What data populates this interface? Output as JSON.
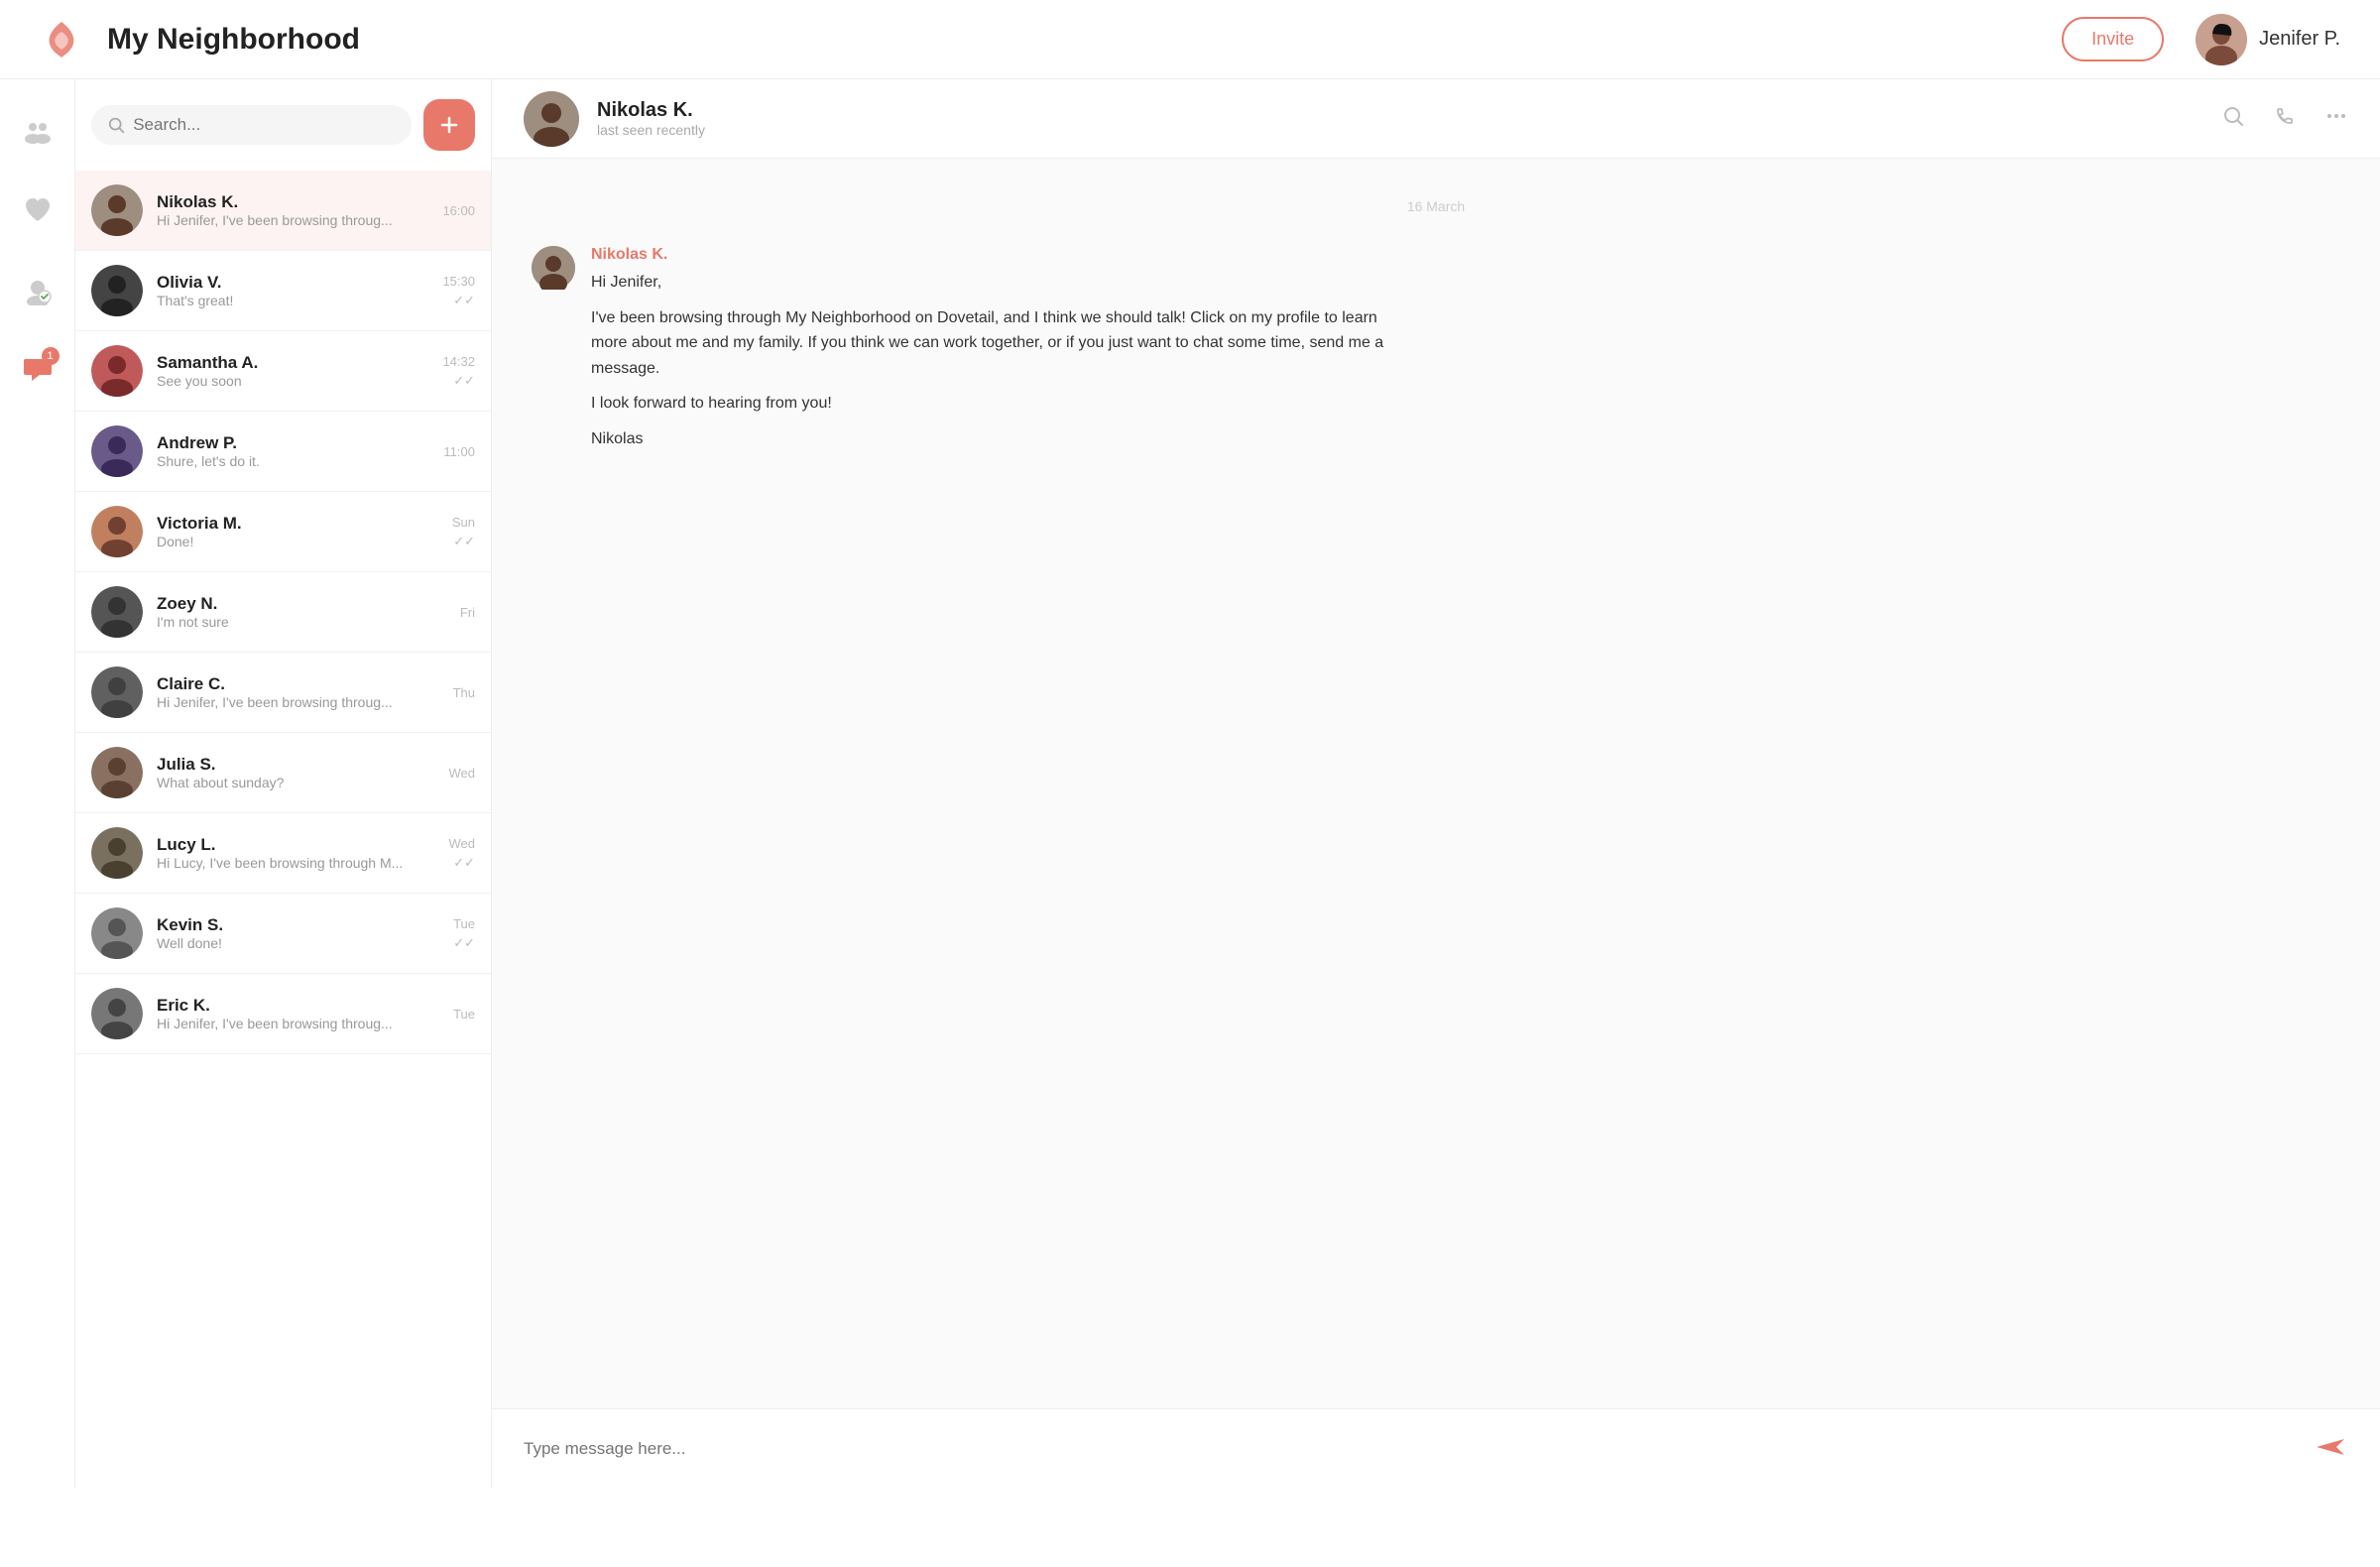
{
  "app": {
    "title": "My Neighborhood",
    "invite_label": "Invite",
    "user_name": "Jenifer P."
  },
  "search": {
    "placeholder": "Search..."
  },
  "contacts": [
    {
      "id": 1,
      "name": "Nikolas K.",
      "preview": "Hi Jenifer, I've been browsing throug...",
      "time": "16:00",
      "tick": false,
      "active": true,
      "av_class": "av-1"
    },
    {
      "id": 2,
      "name": "Olivia V.",
      "preview": "That's great!",
      "time": "15:30",
      "tick": true,
      "active": false,
      "av_class": "av-2"
    },
    {
      "id": 3,
      "name": "Samantha A.",
      "preview": "See you soon",
      "time": "14:32",
      "tick": true,
      "active": false,
      "av_class": "av-3"
    },
    {
      "id": 4,
      "name": "Andrew P.",
      "preview": "Shure, let's do it.",
      "time": "11:00",
      "tick": false,
      "active": false,
      "av_class": "av-4"
    },
    {
      "id": 5,
      "name": "Victoria M.",
      "preview": "Done!",
      "time": "Sun",
      "tick": true,
      "active": false,
      "av_class": "av-5"
    },
    {
      "id": 6,
      "name": "Zoey N.",
      "preview": "I'm not sure",
      "time": "Fri",
      "tick": false,
      "active": false,
      "av_class": "av-6"
    },
    {
      "id": 7,
      "name": "Claire C.",
      "preview": "Hi Jenifer, I've been browsing throug...",
      "time": "Thu",
      "tick": false,
      "active": false,
      "av_class": "av-7"
    },
    {
      "id": 8,
      "name": "Julia S.",
      "preview": "What about sunday?",
      "time": "Wed",
      "tick": false,
      "active": false,
      "av_class": "av-8"
    },
    {
      "id": 9,
      "name": "Lucy L.",
      "preview": "Hi Lucy, I've been browsing through M...",
      "time": "Wed",
      "tick": true,
      "active": false,
      "av_class": "av-9"
    },
    {
      "id": 10,
      "name": "Kevin S.",
      "preview": "Well done!",
      "time": "Tue",
      "tick": true,
      "active": false,
      "av_class": "av-10"
    },
    {
      "id": 11,
      "name": "Eric K.",
      "preview": "Hi Jenifer, I've been browsing throug...",
      "time": "Tue",
      "tick": false,
      "active": false,
      "av_class": "av-11"
    }
  ],
  "chat": {
    "contact_name": "Nikolas K.",
    "contact_status": "last seen recently",
    "date_divider": "16 March",
    "message_sender": "Nikolas K.",
    "message_greeting": "Hi Jenifer,",
    "message_body_1": "I've been browsing through My Neighborhood on Dovetail, and I think we should talk! Click on my profile to learn more about me and my family. If you think we can work together, or if you just want to chat some time, send me a message.",
    "message_body_2": "I look forward to hearing from you!",
    "message_sign": "Nikolas",
    "input_placeholder": "Type message here..."
  },
  "sidebar_icons": [
    {
      "name": "people-icon",
      "label": "People"
    },
    {
      "name": "heart-icon",
      "label": "Favorites"
    },
    {
      "name": "verified-icon",
      "label": "Verified"
    },
    {
      "name": "messages-icon",
      "label": "Messages",
      "badge": "1"
    }
  ]
}
